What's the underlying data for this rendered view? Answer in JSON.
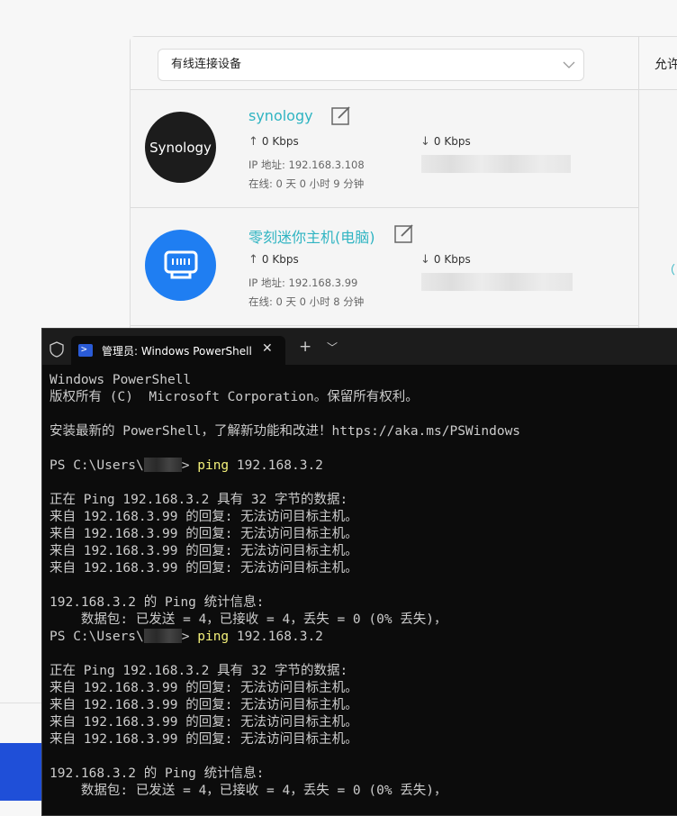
{
  "router": {
    "filter": {
      "selected": "有线连接设备"
    },
    "column_header": "允许",
    "devices": [
      {
        "name": "synology",
        "avatar_text": "Synology",
        "upload": "0 Kbps",
        "download": "0 Kbps",
        "ip": "IP 地址: 192.168.3.108",
        "online": "在线: 0 天 0 小时 9 分钟"
      },
      {
        "name": "零刻迷你主机(电脑)",
        "upload": "0 Kbps",
        "download": "0 Kbps",
        "ip": "IP 地址: 192.168.3.99",
        "online": "在线: 0 天 0 小时 8 分钟",
        "right_text": "（自"
      }
    ]
  },
  "terminal": {
    "tab_title": "管理员: Windows PowerShell",
    "lines": {
      "l1": "Windows PowerShell",
      "l2": "版权所有 (C)  Microsoft Corporation。保留所有权利。",
      "l4": "安装最新的 PowerShell，了解新功能和改进！https://aka.ms/PSWindows",
      "prompt_prefix": "PS C:\\Users\\",
      "prompt_suffix": "> ",
      "cmd": "ping",
      "cmd_arg": " 192.168.3.2",
      "ping_header": "正在 Ping 192.168.3.2 具有 32 字节的数据:",
      "reply": "来自 192.168.3.99 的回复: 无法访问目标主机。",
      "stats_header": "192.168.3.2 的 Ping 统计信息:",
      "stats_packets": "    数据包: 已发送 = 4，已接收 = 4，丢失 = 0 (0% 丢失)，"
    }
  }
}
